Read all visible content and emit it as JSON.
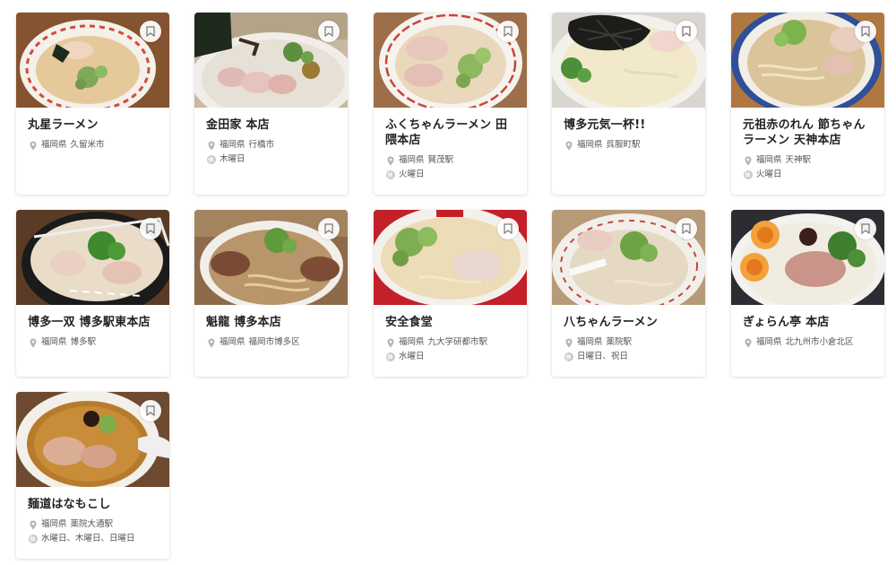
{
  "colors": {
    "card_bg": "#ffffff",
    "meta_text": "#555555",
    "holiday_badge": "#c8c8c8"
  },
  "icons": {
    "location": "map-pin-icon",
    "holiday": "holiday-badge-icon",
    "bookmark": "bookmark-icon"
  },
  "holiday_badge_text": "休",
  "shops": [
    {
      "name": "丸星ラーメン",
      "prefecture": "福岡県",
      "area": "久留米市",
      "holiday": ""
    },
    {
      "name": "金田家 本店",
      "prefecture": "福岡県",
      "area": "行橋市",
      "holiday": "木曜日"
    },
    {
      "name": "ふくちゃんラーメン 田隈本店",
      "prefecture": "福岡県",
      "area": "賀茂駅",
      "holiday": "火曜日"
    },
    {
      "name": "博多元気一杯!!",
      "prefecture": "福岡県",
      "area": "呉服町駅",
      "holiday": ""
    },
    {
      "name": "元祖赤のれん 節ちゃんラーメン 天神本店",
      "prefecture": "福岡県",
      "area": "天神駅",
      "holiday": "火曜日"
    },
    {
      "name": "博多一双 博多駅東本店",
      "prefecture": "福岡県",
      "area": "博多駅",
      "holiday": ""
    },
    {
      "name": "魁龍 博多本店",
      "prefecture": "福岡県",
      "area": "福岡市博多区",
      "holiday": ""
    },
    {
      "name": "安全食堂",
      "prefecture": "福岡県",
      "area": "九大学研都市駅",
      "holiday": "水曜日"
    },
    {
      "name": "八ちゃんラーメン",
      "prefecture": "福岡県",
      "area": "薬院駅",
      "holiday": "日曜日、祝日"
    },
    {
      "name": "ぎょらん亭 本店",
      "prefecture": "福岡県",
      "area": "北九州市小倉北区",
      "holiday": ""
    },
    {
      "name": "麺道はなもこし",
      "prefecture": "福岡県",
      "area": "薬院大通駅",
      "holiday": "水曜日、木曜日、日曜日"
    }
  ]
}
